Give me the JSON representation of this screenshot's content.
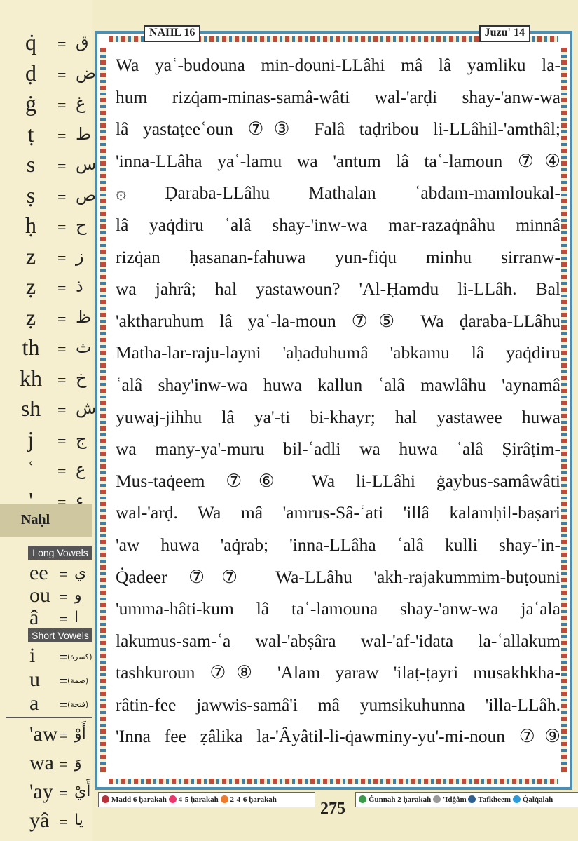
{
  "header": {
    "surah": "NAHL 16",
    "juz": "Juzu' 14"
  },
  "sidebar": {
    "consonants": [
      {
        "lat": "q̇",
        "eq": "=",
        "ar": "ق"
      },
      {
        "lat": "ḍ",
        "eq": "=",
        "ar": "ض"
      },
      {
        "lat": "ġ",
        "eq": "=",
        "ar": "غ"
      },
      {
        "lat": "ṭ",
        "eq": "=",
        "ar": "ط"
      },
      {
        "lat": "s",
        "eq": "=",
        "ar": "س"
      },
      {
        "lat": "ṣ",
        "eq": "=",
        "ar": "ص"
      },
      {
        "lat": "ḥ",
        "eq": "=",
        "ar": "ح"
      },
      {
        "lat": "z",
        "eq": "=",
        "ar": "ز"
      },
      {
        "lat": "ẓ",
        "eq": "=",
        "ar": "ذ"
      },
      {
        "lat": "ẓ",
        "eq": "=",
        "ar": "ظ"
      },
      {
        "lat": "th",
        "eq": "=",
        "ar": "ث"
      },
      {
        "lat": "kh",
        "eq": "=",
        "ar": "خ"
      },
      {
        "lat": "sh",
        "eq": "=",
        "ar": "ش"
      },
      {
        "lat": "j",
        "eq": "=",
        "ar": "ج"
      },
      {
        "lat": "ʿ",
        "eq": "=",
        "ar": "ع"
      },
      {
        "lat": "'",
        "eq": "=",
        "ar": "ء"
      }
    ],
    "surah_tab": "Naḥl",
    "long_vowels_label": "Long Vowels",
    "long_vowels": [
      {
        "lat": "ee",
        "eq": "=",
        "ar": "ي"
      },
      {
        "lat": "ou",
        "eq": "=",
        "ar": "و"
      },
      {
        "lat": "â",
        "eq": "=",
        "ar": "ا"
      }
    ],
    "short_vowels_label": "Short Vowels",
    "short_vowels": [
      {
        "lat": "i",
        "eq": "=",
        "ar": "(كسرة)"
      },
      {
        "lat": "u",
        "eq": "=",
        "ar": "(ضمة)"
      },
      {
        "lat": "a",
        "eq": "=",
        "ar": "(فتحة)"
      }
    ],
    "diphthongs": [
      {
        "lat": "'aw",
        "eq": "=",
        "ar": "أَوْ"
      },
      {
        "lat": "wa",
        "eq": "=",
        "ar": "وَ"
      },
      {
        "lat": "'ay",
        "eq": "=",
        "ar": "أَيْ"
      },
      {
        "lat": "yâ",
        "eq": "=",
        "ar": "يا"
      }
    ]
  },
  "verse_lines": [
    "Wa yaʿ-budouna min-douni-LLâhi mâ lâ yamliku la-",
    "hum rizq̇am-minas-samâ-wâti wal-'arḍi shay-'anw-wa",
    "lâ yastaṭeeʿoun ⑦③ Falâ taḍribou li-LLâhil-'amthâl;",
    "'inna-LLâha yaʿ-lamu wa 'antum lâ taʿ-lamoun ⑦④",
    "۞ Ḍaraba-LLâhu Mathalan ʿabdam-mamloukal-",
    "lâ yaq̇diru ʿalâ shay-'inw-wa mar-razaq̇nâhu minnâ",
    "rizq̇an ḥasanan-fahuwa yun-fiq̇u minhu sirranw-",
    "wa jahrâ; hal yastawoun? 'Al-Ḥamdu li-LLâh. Bal",
    "'aktharuhum lâ yaʿ-la-moun ⑦⑤ Wa ḍaraba-LLâhu",
    "Matha-lar-raju-layni 'aḥaduhumâ 'abkamu lâ yaq̇diru",
    "ʿalâ shay'inw-wa huwa kallun ʿalâ mawlâhu 'aynamâ",
    "yuwaj-jihhu lâ ya'-ti bi-khayr; hal yastawee huwa",
    "wa many-ya'-muru bil-ʿadli wa huwa ʿalâ Ṣirâṭim-",
    "Mus-taq̇eem ⑦⑥ Wa li-LLâhi ġaybus-samâwâti",
    "wal-'arḍ. Wa mâ 'amrus-Sâ-ʿati 'illâ kalamḥil-baṣari",
    "'aw huwa 'aq̇rab; 'inna-LLâha ʿalâ kulli shay-'in-",
    "Q̇adeer ⑦⑦ Wa-LLâhu 'akh-rajakummim-buṭouni",
    "'umma-hâti-kum lâ taʿ-lamouna shay-'anw-wa jaʿala",
    "lakumus-sam-ʿa wal-'abṣâra wal-'af-'idata la-ʿallakum",
    "tashkuroun ⑦⑧ 'Alam yaraw 'ilaṭ-ṭayri musakhkha-",
    "râtin-fee jawwis-samâ'i mâ yumsikuhunna 'illa-LLâh.",
    "'Inna fee ẓâlika la-'Âyâtil-li-q̇awminy-yu'-mi-noun ⑦⑨"
  ],
  "legend": [
    {
      "label": "Madd 6 ḥarakah",
      "color": "#b5323a"
    },
    {
      "label": "4-5 ḥarakah",
      "color": "#e8386b"
    },
    {
      "label": "2-4-6 ḥarakah",
      "color": "#ee7a2e"
    },
    {
      "label": "Ġunnah 2 ḥarakah",
      "color": "#3a9a4a"
    },
    {
      "label": "'Idġâm",
      "color": "#9a9a9a"
    },
    {
      "label": "Tafkheem",
      "color": "#2f5f8f"
    },
    {
      "label": "Q̇alq̇alah",
      "color": "#2f9ad8"
    }
  ],
  "page_number": "275"
}
